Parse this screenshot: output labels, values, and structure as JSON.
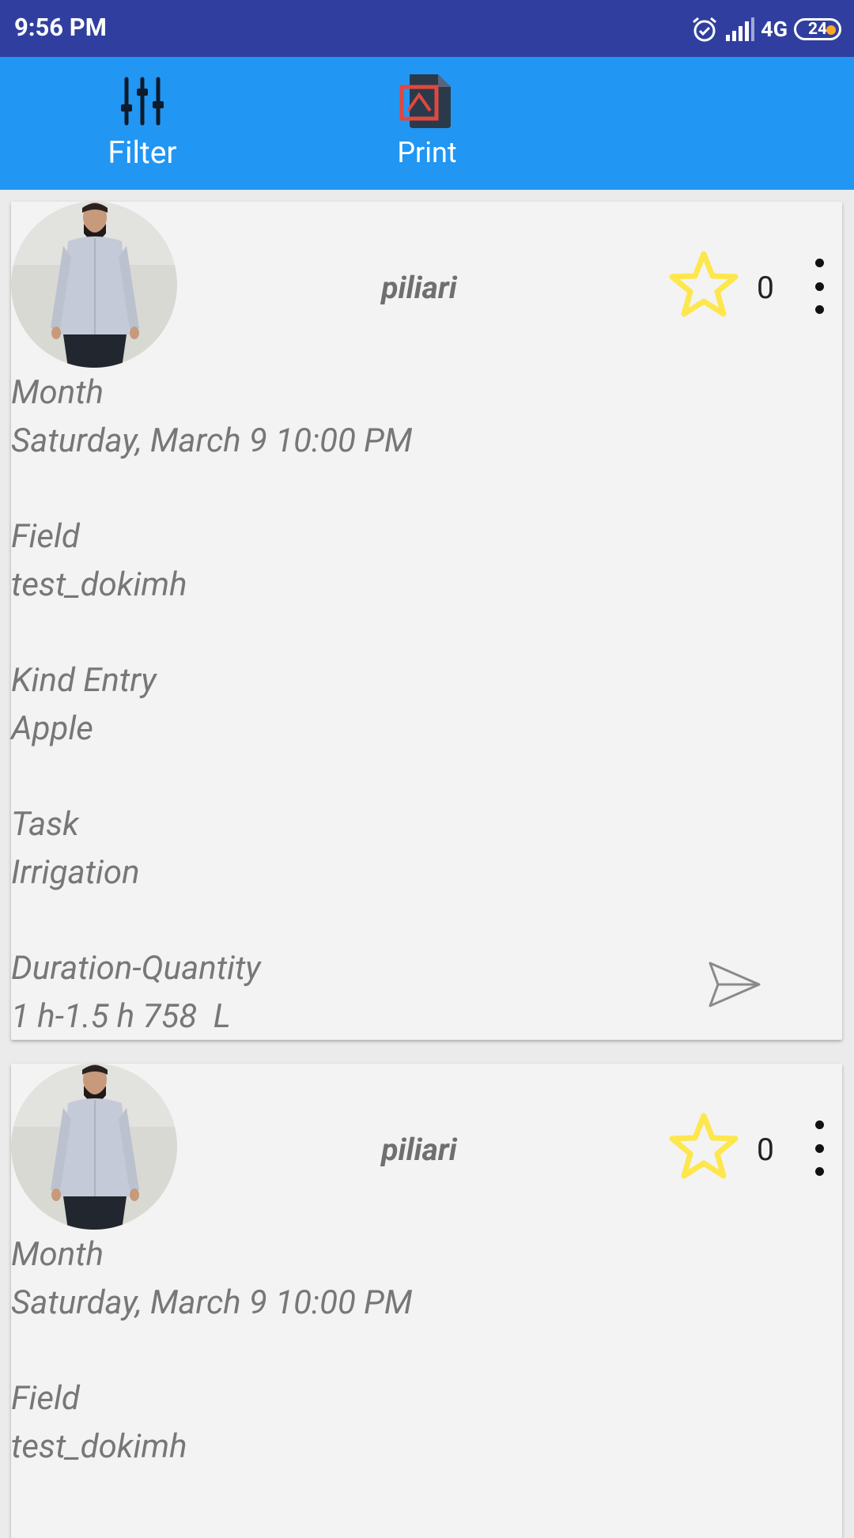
{
  "status_bar": {
    "time": "9:56 PM",
    "network": "4G",
    "battery": "24",
    "icons": [
      "alarm-icon",
      "signal-icon",
      "battery-icon"
    ]
  },
  "toolbar": {
    "filter_label": "Filter",
    "print_label": "Print",
    "icons": [
      "sliders-icon",
      "pdf-icon"
    ]
  },
  "cards": [
    {
      "username": "piliari",
      "star_count": "0",
      "fields": [
        {
          "label": "Month",
          "value": "Saturday, March 9 10:00 PM"
        },
        {
          "label": "Field",
          "value": "test_dokimh"
        },
        {
          "label": "Kind Entry",
          "value": "Apple"
        },
        {
          "label": "Task",
          "value": "Irrigation"
        },
        {
          "label": "Duration-Quantity",
          "value": "1 h-1.5 h 758  L"
        }
      ],
      "icons": [
        "avatar",
        "star-icon",
        "more-vert-icon",
        "send-icon"
      ]
    },
    {
      "username": "piliari",
      "star_count": "0",
      "fields": [
        {
          "label": "Month",
          "value": "Saturday, March 9 10:00 PM"
        },
        {
          "label": "Field",
          "value": "test_dokimh"
        }
      ],
      "icons": [
        "avatar",
        "star-icon",
        "more-vert-icon"
      ]
    }
  ],
  "colors": {
    "status_bar": "#303f9f",
    "toolbar": "#2196f3",
    "card": "#f3f3f3",
    "text_muted": "#777777",
    "star": "#fde74c"
  }
}
